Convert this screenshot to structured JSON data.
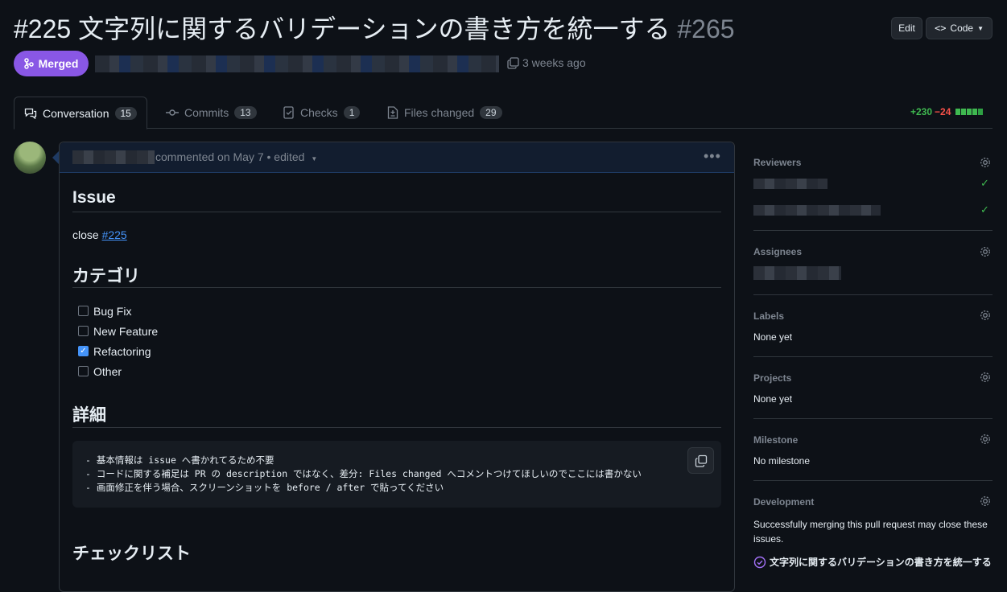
{
  "header": {
    "title": "#225 文字列に関するバリデーションの書き方を統一する",
    "number": "#265",
    "edit_label": "Edit",
    "code_label": "Code",
    "status_label": "Merged",
    "time_ago": "3 weeks ago"
  },
  "tabs": [
    {
      "label": "Conversation",
      "count": "15"
    },
    {
      "label": "Commits",
      "count": "13"
    },
    {
      "label": "Checks",
      "count": "1"
    },
    {
      "label": "Files changed",
      "count": "29"
    }
  ],
  "diffstat": {
    "additions": "+230",
    "deletions": "−24"
  },
  "comment": {
    "meta": "commented on May 7 • edited",
    "h_issue": "Issue",
    "close_text": "close ",
    "close_link": "#225",
    "h_category": "カテゴリ",
    "checkboxes": [
      {
        "label": "Bug Fix",
        "checked": false
      },
      {
        "label": "New Feature",
        "checked": false
      },
      {
        "label": "Refactoring",
        "checked": true
      },
      {
        "label": "Other",
        "checked": false
      }
    ],
    "h_detail": "詳細",
    "code_lines": [
      "- 基本情報は issue へ書かれてるため不要",
      "- コードに関する補足は PR の description ではなく、差分: Files changed へコメントつけてほしいのでここには書かない",
      "- 画面修正を伴う場合、スクリーンショットを before / after で貼ってください"
    ],
    "h_checklist": "チェックリスト"
  },
  "sidebar": {
    "reviewers": "Reviewers",
    "assignees": "Assignees",
    "labels": "Labels",
    "labels_value": "None yet",
    "projects": "Projects",
    "projects_value": "None yet",
    "milestone": "Milestone",
    "milestone_value": "No milestone",
    "development": "Development",
    "development_text": "Successfully merging this pull request may close these issues.",
    "linked_issue": "文字列に関するバリデーションの書き方を統一する"
  },
  "colors": {
    "merged": "#8957e5",
    "link": "#4493f8",
    "additions": "#3fb950",
    "deletions": "#f85149"
  }
}
